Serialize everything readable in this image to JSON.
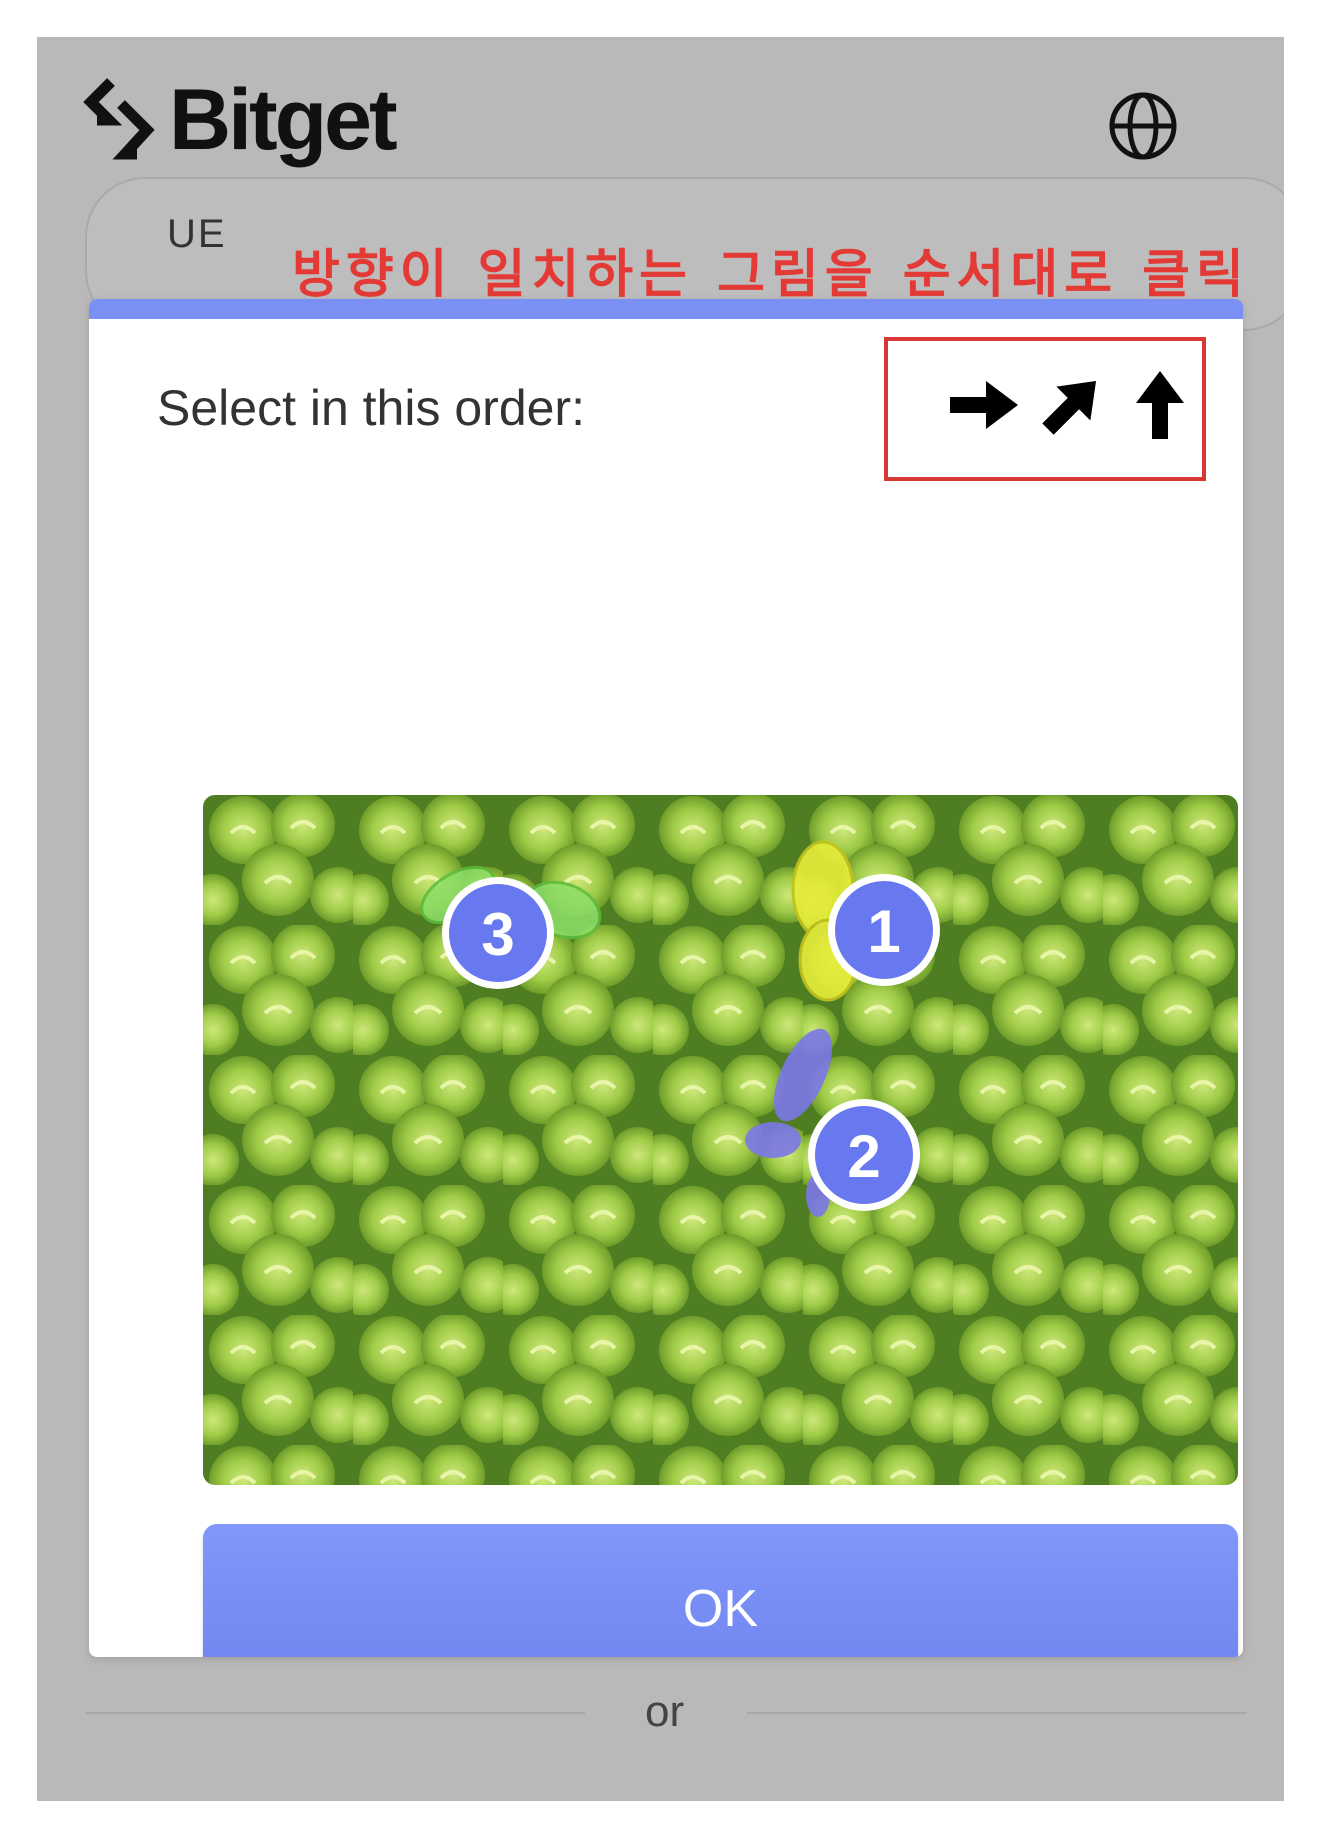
{
  "app": {
    "logo_text": "Bitget",
    "globe_icon": "globe-icon"
  },
  "background": {
    "field_fragment": "UE"
  },
  "annotation": {
    "text": "방향이 일치하는 그림을 순서대로 클릭",
    "color": "#e43a36"
  },
  "captcha": {
    "instruction": "Select in this order:",
    "order_icons": [
      "arrow-right-icon",
      "arrow-up-right-icon",
      "arrow-up-icon"
    ],
    "selections": [
      {
        "label": "1"
      },
      {
        "label": "2"
      },
      {
        "label": "3"
      }
    ],
    "ok_label": "OK",
    "accent_color": "#7b90f5"
  },
  "footer": {
    "or_label": "or"
  }
}
